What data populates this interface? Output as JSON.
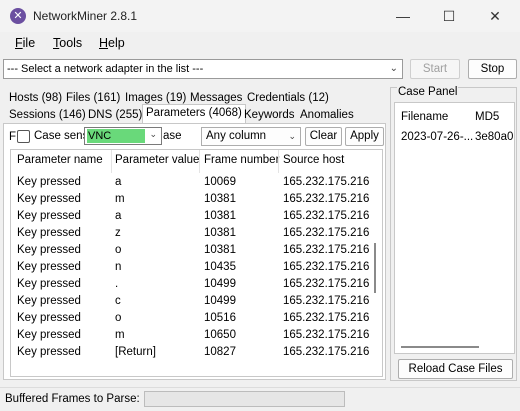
{
  "window": {
    "title": "NetworkMiner 2.8.1",
    "icon": "networkminer-logo-icon",
    "buttons": {
      "minimize": "—",
      "maximize": "☐",
      "close": "✕"
    }
  },
  "menu": [
    {
      "label": "File",
      "mnemonic": "F",
      "rest": "ile"
    },
    {
      "label": "Tools",
      "mnemonic": "T",
      "rest": "ools"
    },
    {
      "label": "Help",
      "mnemonic": "H",
      "rest": "elp"
    }
  ],
  "toolbar": {
    "adapter_select": "--- Select a network adapter in the list ---",
    "start_label": "Start",
    "stop_label": "Stop"
  },
  "tabs": {
    "row1": [
      "Hosts (98)",
      "Files (161)",
      "Images (19)",
      "Messages",
      "Credentials (12)"
    ],
    "row2": [
      "Sessions (146)",
      "DNS (255)",
      "Parameters (4068)",
      "Keywords",
      "Anomalies"
    ],
    "active": "Parameters (4068)"
  },
  "filter": {
    "prefix": "F",
    "case_label": "Case sens",
    "case_checked": false,
    "value": "VNC",
    "match_mode_fragment": "ase",
    "column_scope": "Any column",
    "clear_label": "Clear",
    "apply_label": "Apply"
  },
  "grid": {
    "columns": [
      "Parameter name",
      "Parameter value",
      "Frame number",
      "Source host"
    ],
    "rows": [
      [
        "Key pressed",
        "a",
        "10069",
        "165.232.175.216"
      ],
      [
        "Key pressed",
        "m",
        "10381",
        "165.232.175.216"
      ],
      [
        "Key pressed",
        "a",
        "10381",
        "165.232.175.216"
      ],
      [
        "Key pressed",
        "z",
        "10381",
        "165.232.175.216"
      ],
      [
        "Key pressed",
        "o",
        "10381",
        "165.232.175.216"
      ],
      [
        "Key pressed",
        "n",
        "10435",
        "165.232.175.216"
      ],
      [
        "Key pressed",
        ".",
        "10499",
        "165.232.175.216"
      ],
      [
        "Key pressed",
        "c",
        "10499",
        "165.232.175.216"
      ],
      [
        "Key pressed",
        "o",
        "10516",
        "165.232.175.216"
      ],
      [
        "Key pressed",
        "m",
        "10650",
        "165.232.175.216"
      ],
      [
        "Key pressed",
        "[Return]",
        "10827",
        "165.232.175.216"
      ]
    ]
  },
  "case_panel": {
    "title": "Case Panel",
    "columns": [
      "Filename",
      "MD5"
    ],
    "rows": [
      [
        "2023-07-26-...",
        "3e80a0..."
      ]
    ],
    "reload_label": "Reload Case Files"
  },
  "status": {
    "label": "Buffered Frames to Parse:",
    "progress": 0
  },
  "colors": {
    "filter_highlight": "#69d97a",
    "progress_fill": "#06b025",
    "logo": "#6b4fa0"
  }
}
